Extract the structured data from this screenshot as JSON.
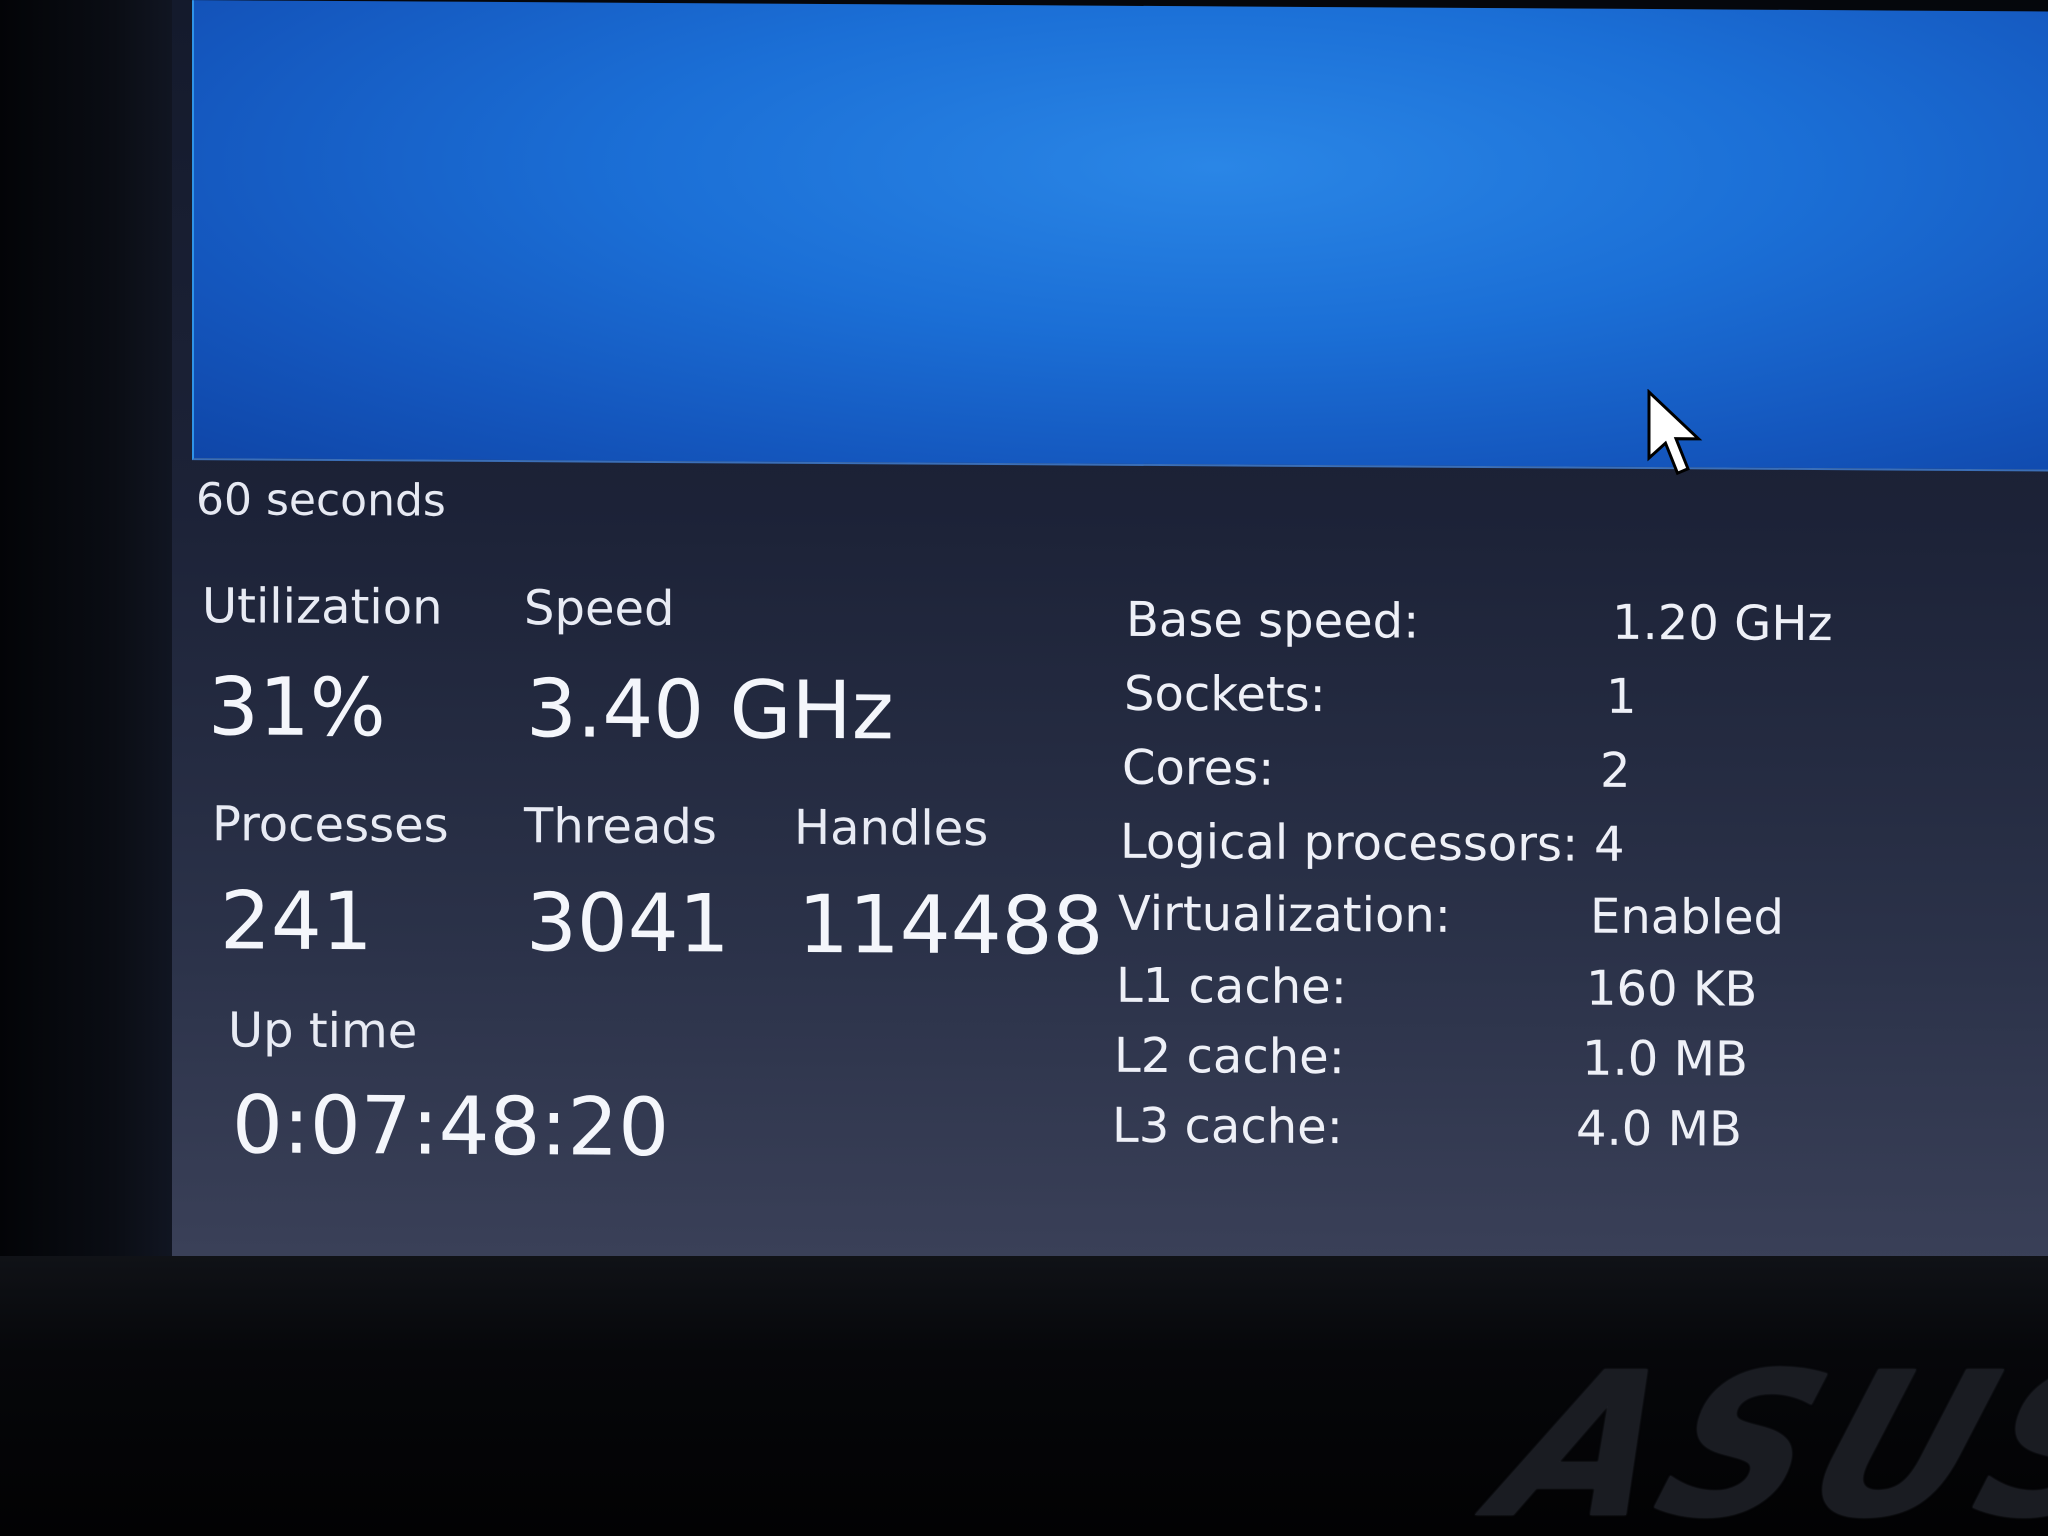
{
  "graph": {
    "time_span_label": "60 seconds"
  },
  "stats": {
    "utilization": {
      "label": "Utilization",
      "value": "31%"
    },
    "speed": {
      "label": "Speed",
      "value": "3.40 GHz"
    },
    "processes": {
      "label": "Processes",
      "value": "241"
    },
    "threads": {
      "label": "Threads",
      "value": "3041"
    },
    "handles": {
      "label": "Handles",
      "value": "114488"
    },
    "up_time": {
      "label": "Up time",
      "value": "0:07:48:20"
    }
  },
  "info": [
    {
      "key": "Base speed:",
      "value": "1.20 GHz"
    },
    {
      "key": "Sockets:",
      "value": "1"
    },
    {
      "key": "Cores:",
      "value": "2"
    },
    {
      "key": "Logical processors:",
      "value": "4"
    },
    {
      "key": "Virtualization:",
      "value": "Enabled"
    },
    {
      "key": "L1 cache:",
      "value": "160 KB"
    },
    {
      "key": "L2 cache:",
      "value": "1.0 MB"
    },
    {
      "key": "L3 cache:",
      "value": "4.0 MB"
    }
  ],
  "device": {
    "brand_logo": "ASUS"
  },
  "colors": {
    "graph_blue": "#1b6fd6",
    "panel_bg": "#1c2237",
    "text": "#eef0f7"
  }
}
